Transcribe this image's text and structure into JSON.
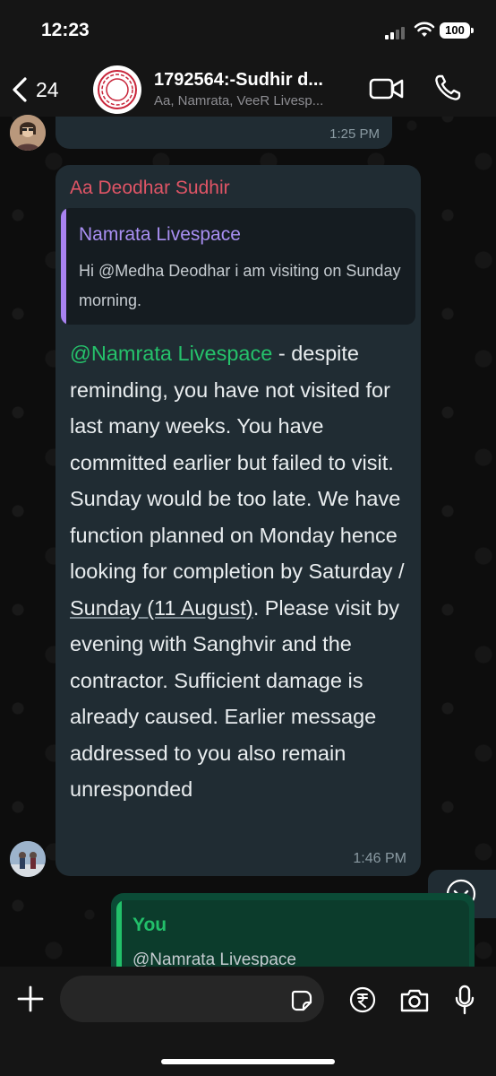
{
  "status_bar": {
    "time": "12:23",
    "battery": "100"
  },
  "header": {
    "back_count": "24",
    "title": "1792564:-Sudhir d...",
    "subtitle": "Aa, Namrata, VeeR Livesp..."
  },
  "prev_message": {
    "time": "1:25 PM"
  },
  "message": {
    "sender": "Aa Deodhar Sudhir",
    "quote": {
      "name": "Namrata Livespace",
      "text": "Hi @Medha Deodhar  i am visiting on Sunday morning."
    },
    "mention": "@Namrata Livespace",
    "text_part1": " - despite reminding, you have not visited for last many weeks. You have committed earlier but failed to visit. Sunday would be too late. We have function planned on Monday hence looking for completion by Saturday / ",
    "date_link": "Sunday (11 August)",
    "text_part2": ". Please visit by evening with Sanghvir and the contractor. Sufficient damage is already caused. Earlier message addressed to you also remain unresponded",
    "time": "1:46 PM"
  },
  "reply_preview": {
    "label": "You",
    "text": "@Namrata Livespace"
  },
  "input": {
    "placeholder": ""
  },
  "colors": {
    "mention": "#25c26b",
    "sender": "#e05566",
    "quote_name": "#a98ff2",
    "bubble": "#202c33"
  }
}
